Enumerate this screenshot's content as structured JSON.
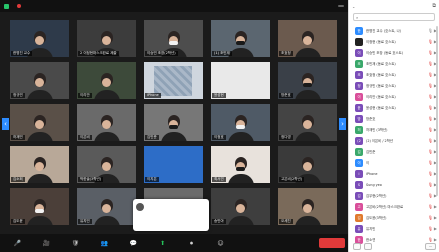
{
  "meeting": {
    "top_bar": {
      "label": "",
      "view_label": ""
    },
    "tiles": [
      {
        "name": "한명진 교수",
        "active": true,
        "bg": "#2e3a4a",
        "style": "person",
        "mask": false
      },
      {
        "name": "2 이정현마스크완료 제출",
        "bg": "#3c3c3c",
        "style": "person",
        "mask": false
      },
      {
        "name": "이승민 조장(2학년)",
        "bg": "#4d4d4d",
        "style": "person",
        "mask": true
      },
      {
        "name": "(1) 조민재",
        "bg": "#5b6670",
        "style": "person",
        "mask": true
      },
      {
        "name": "조효정",
        "bg": "#6b5a4e",
        "style": "person",
        "mask": false
      },
      {
        "name": "정규민",
        "bg": "#4a4a4a",
        "style": "person",
        "mask": false
      },
      {
        "name": "이리안",
        "bg": "#3d4a3a",
        "style": "person",
        "mask": false
      },
      {
        "name": "iPhone",
        "bg": "#cfd6de",
        "style": "floral"
      },
      {
        "name": "윤성현",
        "bg": "#f0f0f0",
        "style": "frame"
      },
      {
        "name": "방준호",
        "bg": "#3a4048",
        "style": "person",
        "mask": true
      },
      {
        "name": "허재민",
        "bg": "#5a5048",
        "style": "person",
        "mask": false
      },
      {
        "name": "이은비",
        "bg": "#6a6a6a",
        "style": "person",
        "mask": false
      },
      {
        "name": "김민준",
        "bg": "#777777",
        "style": "person",
        "mask": true
      },
      {
        "name": "이정호",
        "bg": "#4f5a66",
        "style": "person",
        "mask": true
      },
      {
        "name": "정다영",
        "bg": "#444",
        "style": "person",
        "mask": false
      },
      {
        "name": "김소희",
        "bg": "#b8a898",
        "style": "person",
        "mask": false
      },
      {
        "name": "박한솔(3학년)",
        "bg": "#5a5a5a",
        "style": "person",
        "mask": false
      },
      {
        "name": "이지은",
        "bg": "#2d6dc7",
        "style": "blue"
      },
      {
        "name": "최서연",
        "bg": "#e8e2dc",
        "style": "person",
        "mask": true
      },
      {
        "name": "고은비(2학년)",
        "bg": "#3a3a3a",
        "style": "person",
        "mask": false
      },
      {
        "name": "김도윤",
        "bg": "#4b3f39",
        "style": "person",
        "mask": true
      },
      {
        "name": "유지민",
        "bg": "#5a5f66",
        "style": "person",
        "mask": false
      },
      {
        "name": "한소연",
        "bg": "#6b6b6b",
        "style": "person",
        "mask": true
      },
      {
        "name": "송민아",
        "bg": "#3e3e3e",
        "style": "person",
        "mask": false
      },
      {
        "name": "오세진",
        "bg": "#7a6a5a",
        "style": "person",
        "mask": false
      },
      {
        "name": "임하은",
        "bg": "#4a4a50",
        "style": "person",
        "mask": true
      },
      {
        "name": "장준영",
        "bg": "#555",
        "style": "person",
        "mask": true
      },
      {
        "name": "신우현",
        "bg": "#3a3a3a",
        "style": "person",
        "mask": true
      },
      {
        "name": "서지원",
        "bg": "#b9a58f",
        "style": "book"
      },
      {
        "name": "황민서",
        "bg": "#3c3c3c",
        "style": "person",
        "mask": false
      }
    ],
    "toast": {
      "line1": "",
      "line2": ""
    },
    "toolbar": [
      {
        "id": "mic",
        "icon": "🎤",
        "label": ""
      },
      {
        "id": "video",
        "icon": "🎥",
        "label": ""
      },
      {
        "id": "security",
        "icon": "🛡",
        "label": ""
      },
      {
        "id": "participants",
        "icon": "👥",
        "label": ""
      },
      {
        "id": "chat",
        "icon": "💬",
        "label": ""
      },
      {
        "id": "share",
        "icon": "⬆",
        "label": ""
      },
      {
        "id": "record",
        "icon": "⏺",
        "label": ""
      },
      {
        "id": "reactions",
        "icon": "☺",
        "label": ""
      }
    ],
    "leave_label": ""
  },
  "panel": {
    "title": "",
    "search_placeholder": "",
    "participants": [
      {
        "name": "한명진 교수 (호스트, 나)",
        "color": "#2d8cff",
        "initial": "한",
        "mic": "on",
        "cam": "on"
      },
      {
        "name": "이정현 (동료 호스트)",
        "color": "#222222",
        "initial": "",
        "mic": "off",
        "cam": "on"
      },
      {
        "name": "이승민 조장 (동료 호스트)",
        "color": "#7a4db8",
        "initial": "이",
        "mic": "off",
        "cam": "on"
      },
      {
        "name": "조민재 (동료 호스트)",
        "color": "#3aa86b",
        "initial": "조",
        "mic": "off",
        "cam": "on"
      },
      {
        "name": "조효정 (동료 호스트)",
        "color": "#7a4db8",
        "initial": "조",
        "mic": "off",
        "cam": "on"
      },
      {
        "name": "정규민 (동료 호스트)",
        "color": "#7a4db8",
        "initial": "정",
        "mic": "off",
        "cam": "on"
      },
      {
        "name": "이리안 (동료 호스트)",
        "color": "#d94f9a",
        "initial": "이",
        "mic": "off",
        "cam": "on"
      },
      {
        "name": "윤성현 (동료 호스트)",
        "color": "#7a4db8",
        "initial": "윤",
        "mic": "off",
        "cam": "on"
      },
      {
        "name": "방준호",
        "color": "#7a4db8",
        "initial": "방",
        "mic": "off",
        "cam": "on"
      },
      {
        "name": "허재민 (3학년)",
        "color": "#3aa86b",
        "initial": "허",
        "mic": "off",
        "cam": "on"
      },
      {
        "name": "(2) 이은비 / 2학년",
        "color": "#7a4db8",
        "initial": "(2",
        "mic": "off",
        "cam": "on"
      },
      {
        "name": "김민준",
        "color": "#3aa86b",
        "initial": "김",
        "mic": "off",
        "cam": "on"
      },
      {
        "name": "이",
        "color": "#2d8cff",
        "initial": "이",
        "mic": "off",
        "cam": "on"
      },
      {
        "name": "iPhone",
        "color": "#7a4db8",
        "initial": "i",
        "mic": "off",
        "cam": "on"
      },
      {
        "name": "Sung yeo",
        "color": "#7a4db8",
        "initial": "S",
        "mic": "off",
        "cam": "on"
      },
      {
        "name": "김우현(2학년)",
        "color": "#7a4db8",
        "initial": "김",
        "mic": "off",
        "cam": "on"
      },
      {
        "name": "고은비(2학년) 마스크완료",
        "color": "#d94f9a",
        "initial": "고",
        "mic": "off",
        "cam": "on"
      },
      {
        "name": "김도윤(3학년)",
        "color": "#e07a2d",
        "initial": "김",
        "mic": "off",
        "cam": "on"
      },
      {
        "name": "유지민",
        "color": "#7a4db8",
        "initial": "유",
        "mic": "off",
        "cam": "on"
      },
      {
        "name": "한소연",
        "color": "#d94f9a",
        "initial": "한",
        "mic": "off",
        "cam": "on"
      }
    ],
    "footer": {
      "invite": "",
      "mute_all": "",
      "more": "..."
    }
  }
}
